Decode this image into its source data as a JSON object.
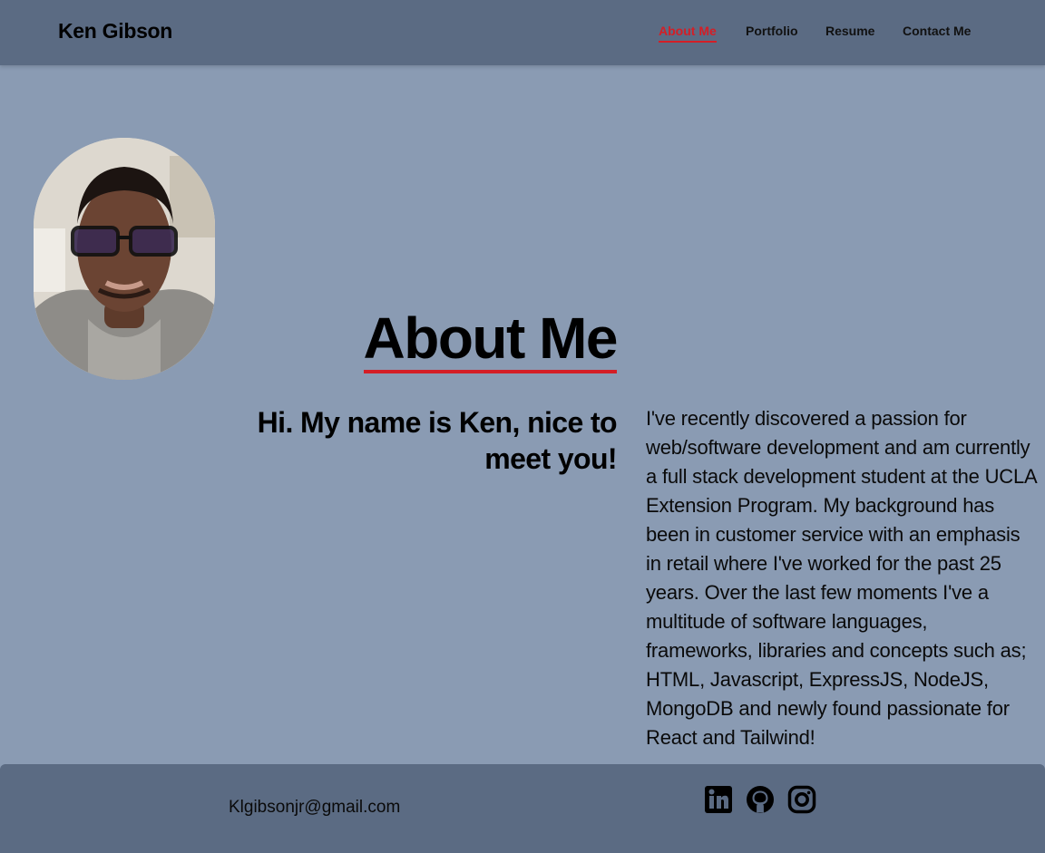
{
  "header": {
    "brand": "Ken Gibson",
    "nav": [
      {
        "label": "About Me"
      },
      {
        "label": "Portfolio"
      },
      {
        "label": "Resume"
      },
      {
        "label": "Contact Me"
      }
    ],
    "active_color": "#d41e26"
  },
  "main": {
    "heading": "About Me",
    "greeting": "Hi. My name is Ken, nice to meet you!",
    "bio": "I've recently discovered a passion for web/software development and am currently a full stack development student at the UCLA Extension Program. My background has been in customer service with an emphasis in retail where I've worked for the past 25 years. Over the last few moments I've a multitude of software languages, frameworks, libraries and concepts such as; HTML, Javascript, ExpressJS, NodeJS, MongoDB and newly found passionate for React and Tailwind!"
  },
  "footer": {
    "email": "Klgibsonjr@gmail.com",
    "social_icons": [
      "linkedin-icon",
      "github-icon",
      "instagram-icon"
    ]
  },
  "colors": {
    "page_bg": "#8a9bb3",
    "bar_bg": "#5b6b83",
    "accent": "#d41e26"
  }
}
